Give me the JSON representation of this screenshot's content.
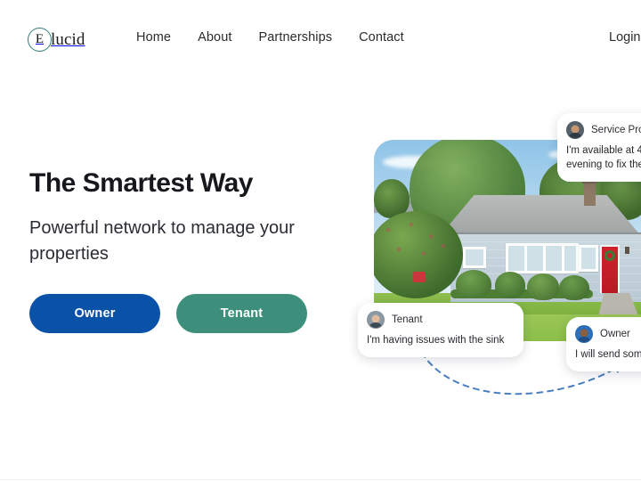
{
  "brand": {
    "mark_letter": "E",
    "word": "lucid",
    "accent_circle_color": "#2f7d78"
  },
  "nav": {
    "items": [
      {
        "label": "Home"
      },
      {
        "label": "About"
      },
      {
        "label": "Partnerships"
      },
      {
        "label": "Contact"
      }
    ],
    "login_label": "Login"
  },
  "hero": {
    "headline": "The Smartest Way",
    "subheading": "Powerful network to manage your properties",
    "buttons": [
      {
        "label": "Owner",
        "color": "#0a52a8"
      },
      {
        "label": "Tenant",
        "color": "#3d8f7c"
      }
    ]
  },
  "chat": {
    "service_provider": {
      "name": "Service Prov",
      "message": "I'm available at 4\nevening to fix the",
      "avatar": "service-provider-avatar"
    },
    "tenant": {
      "name": "Tenant",
      "message": "I'm having issues with the sink",
      "avatar": "tenant-avatar"
    },
    "owner": {
      "name": "Owner",
      "message": "I will send som",
      "avatar": "owner-avatar"
    }
  },
  "decor": {
    "arrow_color": "#4a7fc1"
  }
}
